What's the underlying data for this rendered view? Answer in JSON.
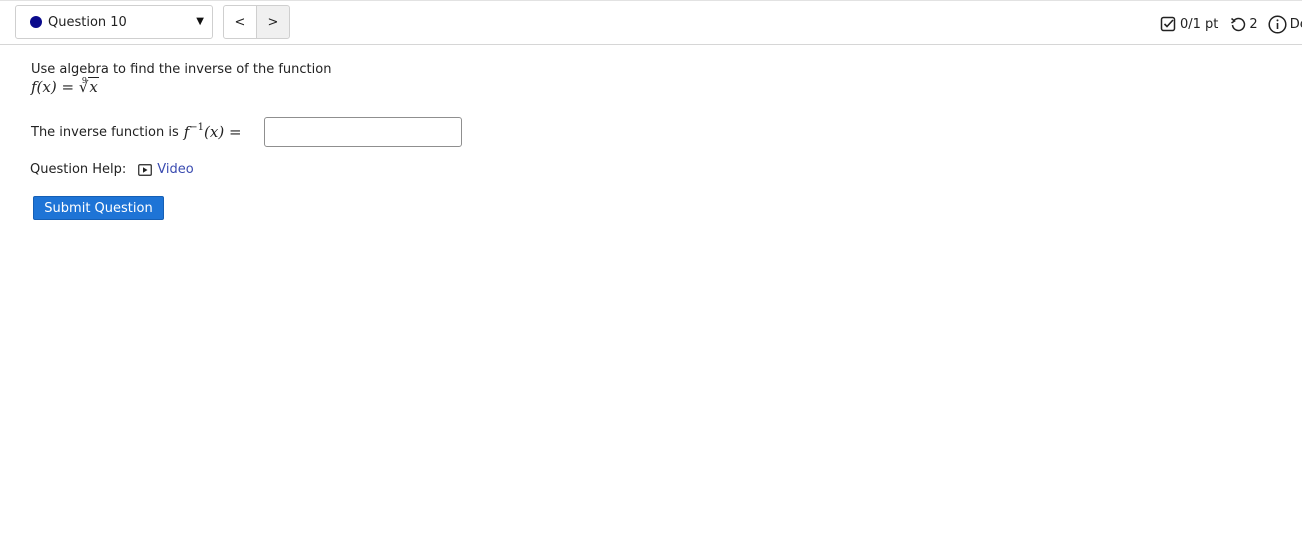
{
  "header": {
    "question_selector": {
      "label": "Question 10",
      "dot_color": "#0a0a8c"
    },
    "prev_label": "<",
    "next_label": ">",
    "score": "0/1 pt",
    "tries": "2",
    "details_label": "De"
  },
  "question": {
    "prompt": "Use algebra to find the inverse of the function",
    "function_lhs": "f(x) =",
    "root_index": "9",
    "radicand": "x",
    "inverse_text": "The inverse function is",
    "inverse_f": "f",
    "inverse_exp": "−1",
    "inverse_arg": "(x) =",
    "answer_value": ""
  },
  "help": {
    "label": "Question Help:",
    "video_label": "Video"
  },
  "submit_label": "Submit Question",
  "colors": {
    "accent": "#1e74d6",
    "link": "#3a4bb0"
  }
}
